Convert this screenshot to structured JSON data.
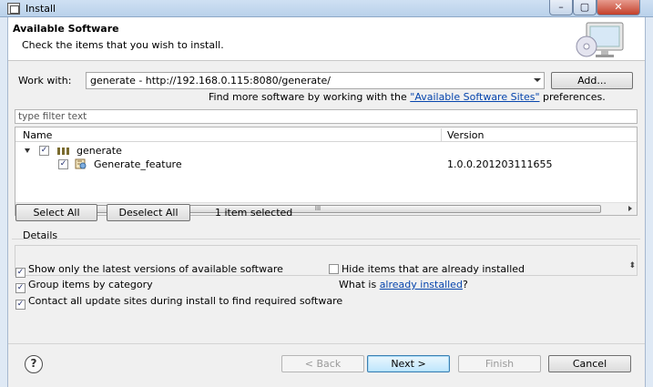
{
  "window": {
    "title": "Install",
    "controls": {
      "minimize": "–",
      "maximize": "▢",
      "close": "✕"
    }
  },
  "header": {
    "title": "Available Software",
    "description": "Check the items that you wish to install."
  },
  "work_with": {
    "label": "Work with:",
    "value": "generate - http://192.168.0.115:8080/generate/",
    "add_button": "Add...",
    "hint_prefix": "Find more software by working with the ",
    "hint_link": "\"Available Software Sites\"",
    "hint_suffix": " preferences."
  },
  "filter": {
    "placeholder": "type filter text"
  },
  "tree": {
    "columns": {
      "name": "Name",
      "version": "Version"
    },
    "rows": [
      {
        "name": "generate",
        "version": "",
        "checked": true,
        "icon": "category-icon"
      },
      {
        "name": "Generate_feature",
        "version": "1.0.0.201203111655",
        "checked": true,
        "icon": "feature-icon"
      }
    ],
    "scroll_grip": "III"
  },
  "selection": {
    "select_all": "Select All",
    "deselect_all": "Deselect All",
    "status": "1 item selected"
  },
  "details": {
    "label": "Details",
    "scroll_glyph": "⬍"
  },
  "options": {
    "latest_versions": {
      "label": "Show only the latest versions of available software",
      "checked": true
    },
    "hide_installed": {
      "label": "Hide items that are already installed",
      "checked": false
    },
    "group_by_category": {
      "label": "Group items by category",
      "checked": true
    },
    "what_is_prefix": "What is ",
    "what_is_link": "already installed",
    "what_is_suffix": "?",
    "contact_sites": {
      "label": "Contact all update sites during install to find required software",
      "checked": true
    }
  },
  "footer": {
    "help_glyph": "?",
    "back": "< Back",
    "next": "Next >",
    "finish": "Finish",
    "cancel": "Cancel"
  },
  "check_glyph": "✓"
}
